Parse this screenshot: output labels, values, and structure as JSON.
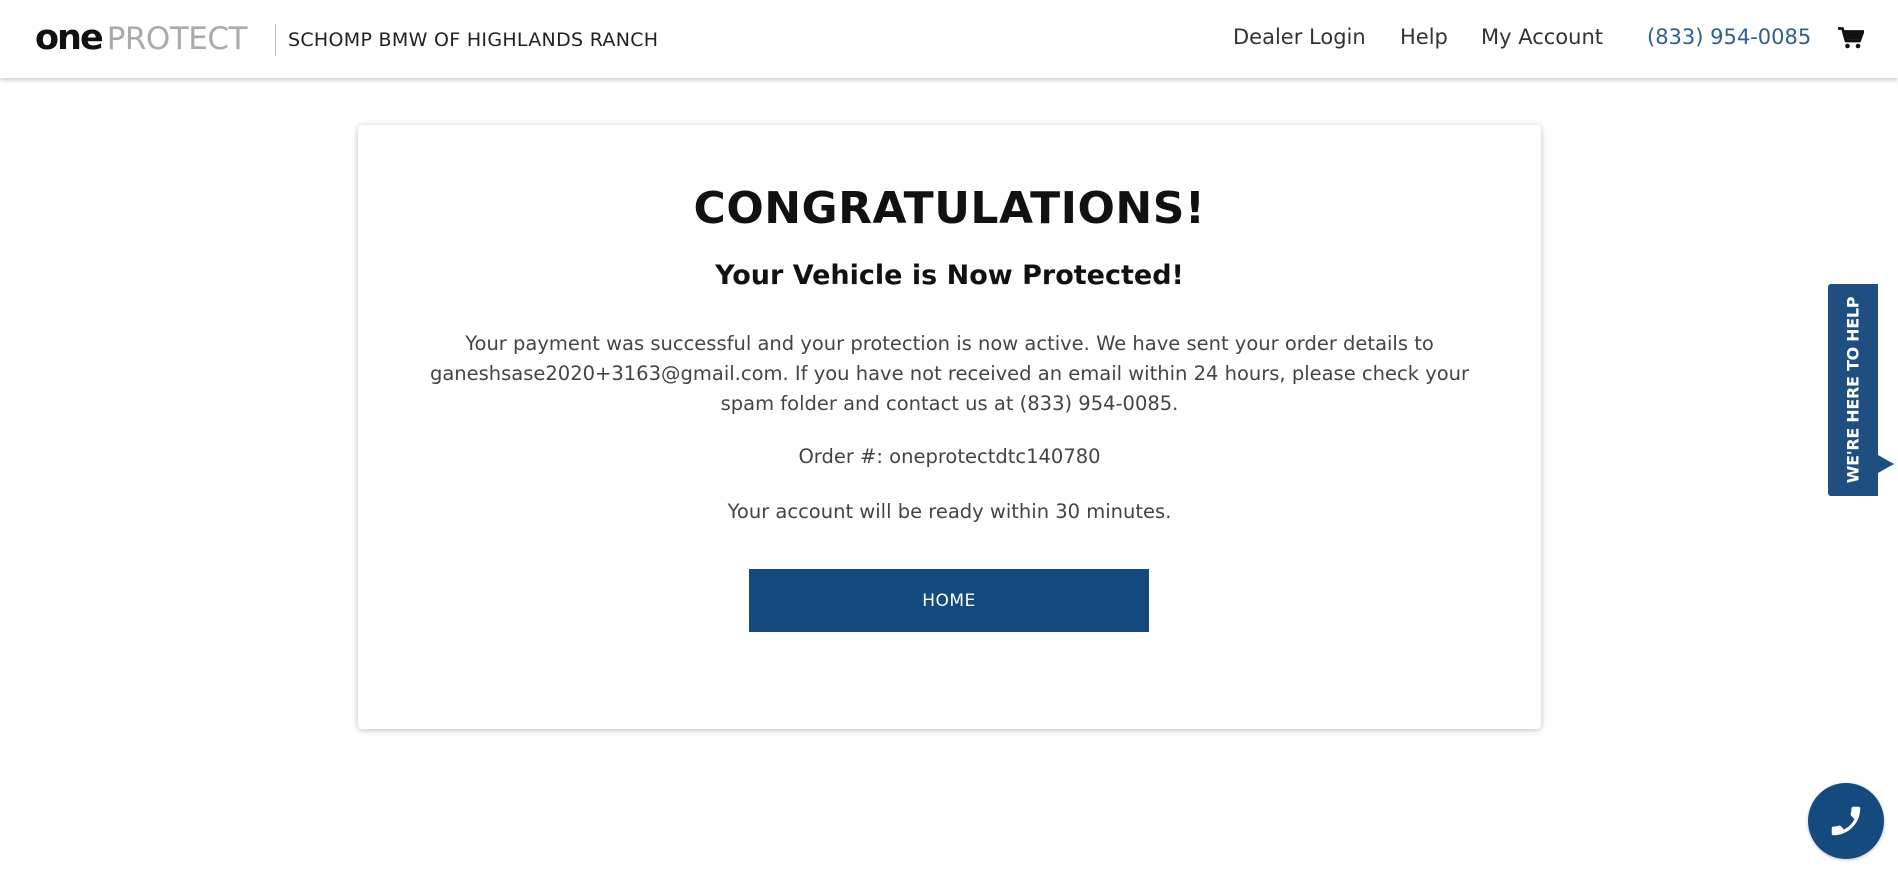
{
  "header": {
    "logo_one": "one",
    "logo_protect": "PROTECT",
    "dealer_name": "SCHOMP BMW OF HIGHLANDS RANCH",
    "nav": {
      "dealer_login": "Dealer Login",
      "help": "Help",
      "my_account": "My Account",
      "phone": "(833) 954-0085"
    },
    "cart_icon": "shopping-cart-icon"
  },
  "confirmation": {
    "title": "CONGRATULATIONS!",
    "subtitle": "Your Vehicle is Now Protected!",
    "message": "Your payment was successful and your protection is now active. We have sent your order details to ganeshsase2020+3163@gmail.com. If you have not received an email within 24 hours, please check your spam folder and contact us at (833) 954-0085.",
    "order_number": "Order #: oneprotectdtc140780",
    "account_ready": "Your account will be ready within 30 minutes.",
    "home_button": "HOME"
  },
  "help_tab": {
    "label": "WE'RE HERE TO HELP"
  },
  "call_button": {
    "icon": "phone-icon"
  },
  "colors": {
    "primary": "#154a7e",
    "phone_link": "#2f5f92",
    "logo_gray": "#aaaaaa"
  }
}
